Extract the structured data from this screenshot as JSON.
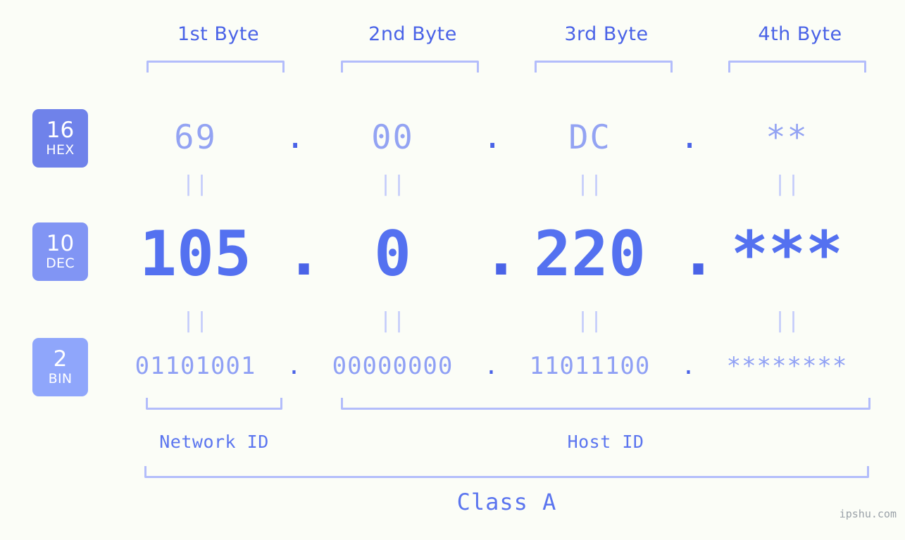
{
  "background_color": "#fbfdf7",
  "accent_color": "#4a63e7",
  "bracket_color": "#b3bdfb",
  "byte_headers": [
    {
      "label": "1st Byte"
    },
    {
      "label": "2nd Byte"
    },
    {
      "label": "3rd Byte"
    },
    {
      "label": "4th Byte"
    }
  ],
  "bases": [
    {
      "num": "16",
      "name": "HEX",
      "color": "#6f82ea"
    },
    {
      "num": "10",
      "name": "DEC",
      "color": "#8195f4"
    },
    {
      "num": "2",
      "name": "BIN",
      "color": "#8fa6fb"
    }
  ],
  "separator": ".",
  "equals_mark": "||",
  "rows": {
    "hex": {
      "values": [
        "69",
        "00",
        "DC",
        "**"
      ]
    },
    "dec": {
      "values": [
        "105",
        "0",
        "220",
        "***"
      ]
    },
    "bin": {
      "values": [
        "01101001",
        "00000000",
        "11011100",
        "********"
      ]
    }
  },
  "id_labels": {
    "network": "Network ID",
    "host": "Host ID"
  },
  "class_label": "Class A",
  "watermark": "ipshu.com"
}
